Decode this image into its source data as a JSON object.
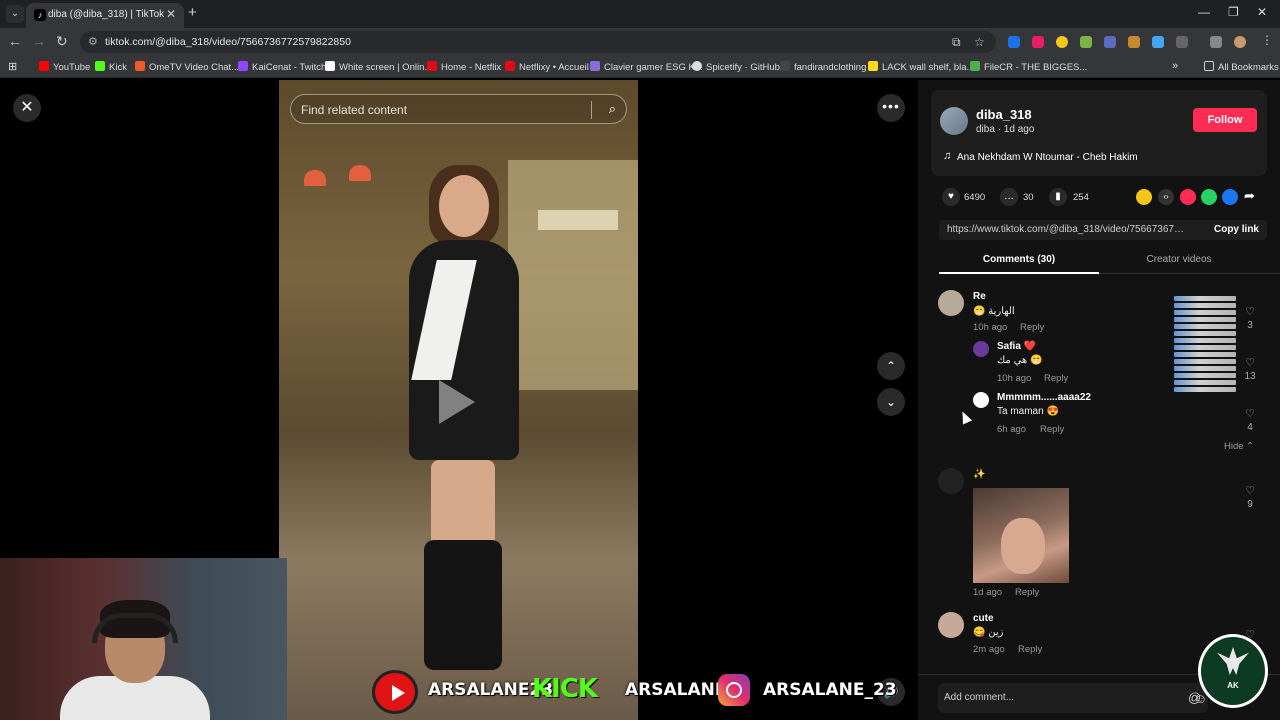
{
  "browser": {
    "tab_title": "diba (@diba_318) | TikTok",
    "url": "tiktok.com/@diba_318/video/7566736772579822850",
    "bookmarks": [
      {
        "label": "YouTube",
        "color": "#ff0000"
      },
      {
        "label": "Kick",
        "color": "#53fc18"
      },
      {
        "label": "OmeTV Video Chat...",
        "color": "#f05a28"
      },
      {
        "label": "KaiCenat - Twitch",
        "color": "#9146ff"
      },
      {
        "label": "White screen | Onlin...",
        "color": "#ffffff"
      },
      {
        "label": "Home - Netflix",
        "color": "#e50914"
      },
      {
        "label": "Netflixy • Accueil",
        "color": "#e50914"
      },
      {
        "label": "Clavier gamer ESG K...",
        "color": "#8a6cd8"
      },
      {
        "label": "Spicetify · GitHub",
        "color": "#dddddd"
      },
      {
        "label": "fandirandclothing",
        "color": "#444444"
      },
      {
        "label": "LACK wall shelf, bla...",
        "color": "#ffda1a"
      },
      {
        "label": "FileCR - THE BIGGES...",
        "color": "#4caf50"
      }
    ],
    "all_bookmarks": "All Bookmarks"
  },
  "video": {
    "search_placeholder": "Find related content"
  },
  "social_banner": {
    "youtube": "ARSALANE23",
    "kick_logo": "KICK",
    "kick": "ARSALANE1",
    "instagram": "ARSALANE_23"
  },
  "author": {
    "username": "diba_318",
    "subline": "diba · 1d ago",
    "follow_label": "Follow",
    "music": "Ana Nekhdam W Ntoumar - Cheb Hakim"
  },
  "stats": {
    "likes": "6490",
    "comments": "30",
    "saves": "254"
  },
  "share_colors": [
    "#f5c518",
    "#333333",
    "#fe2c55",
    "#25d366",
    "#1877f2"
  ],
  "link": {
    "url": "https://www.tiktok.com/@diba_318/video/7566736772...",
    "copy_label": "Copy link"
  },
  "tabs": {
    "comments": "Comments (30)",
    "creator": "Creator videos"
  },
  "comments": [
    {
      "name": "Re",
      "text": "😁 الهارية",
      "time": "10h ago",
      "reply": "Reply",
      "likes": "3"
    },
    {
      "name": "Safia ❤️",
      "text": "هي مك 😁",
      "time": "10h ago",
      "reply": "Reply",
      "likes": "13"
    },
    {
      "name": "Mmmmm......aaaa22",
      "text": "Ta maman 😍",
      "time": "6h ago",
      "reply": "Reply",
      "likes": "4"
    },
    {
      "name": "✨",
      "text": "",
      "time": "1d ago",
      "reply": "Reply",
      "likes": "9"
    },
    {
      "name": "cute",
      "text": "😋 زين",
      "time": "2m ago",
      "reply": "Reply",
      "likes": ""
    }
  ],
  "hide_label": "Hide",
  "add_comment_placeholder": "Add comment...",
  "ak_logo_text": "AK"
}
